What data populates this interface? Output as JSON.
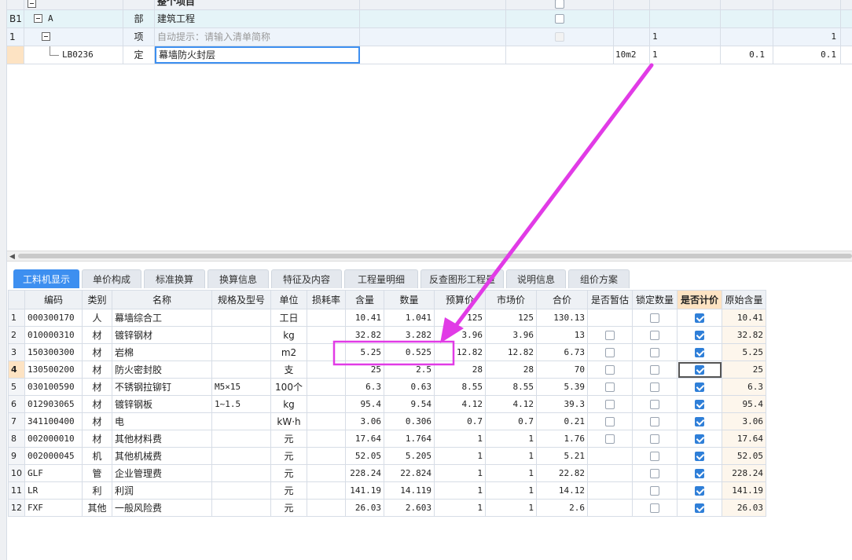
{
  "top_grid": {
    "header_title": "整个项目",
    "rows": [
      {
        "no": "B1",
        "code": "A",
        "type": "部",
        "name": "建筑工程",
        "name_hint": false,
        "unit": "",
        "qty_expr": "",
        "qty": "",
        "col_a": "",
        "col_b": "",
        "checkbox": "empty"
      },
      {
        "no": "1",
        "code": "",
        "type": "项",
        "name": "自动提示：请输入清单简称",
        "name_hint": true,
        "unit": "",
        "qty_expr": "1",
        "qty": "",
        "col_a": "",
        "col_b": "1",
        "checkbox": "dim"
      },
      {
        "no": "",
        "code": "LB0236",
        "type": "定",
        "name": "幕墙防火封层",
        "name_hint": false,
        "unit": "10m2",
        "qty_expr": "1",
        "qty": "",
        "col_a": "0.1",
        "col_b": "0.1",
        "checkbox": "none"
      }
    ]
  },
  "tabs": [
    "工料机显示",
    "单价构成",
    "标准换算",
    "换算信息",
    "特征及内容",
    "工程量明细",
    "反查图形工程量",
    "说明信息",
    "组价方案"
  ],
  "active_tab": 0,
  "table": {
    "headers": [
      "",
      "编码",
      "类别",
      "名称",
      "规格及型号",
      "单位",
      "损耗率",
      "含量",
      "数量",
      "预算价",
      "市场价",
      "合价",
      "是否暂估",
      "锁定数量",
      "是否计价",
      "原始含量"
    ],
    "highlight_header": 14,
    "selected_row": 3,
    "rows": [
      {
        "no": "1",
        "code": "000300170",
        "cat": "人",
        "name": "幕墙综合工",
        "spec": "",
        "unit": "工日",
        "loss": "",
        "content": "10.41",
        "qty": "1.041",
        "budget": "125",
        "market": "125",
        "total": "130.13",
        "est": false,
        "lock": true,
        "priced": true,
        "orig": "10.41"
      },
      {
        "no": "2",
        "code": "010000310",
        "cat": "材",
        "name": "镀锌钢材",
        "spec": "",
        "unit": "kg",
        "loss": "",
        "content": "32.82",
        "qty": "3.282",
        "budget": "3.96",
        "market": "3.96",
        "total": "13",
        "est": true,
        "lock": true,
        "priced": true,
        "orig": "32.82"
      },
      {
        "no": "3",
        "code": "150300300",
        "cat": "材",
        "name": "岩棉",
        "spec": "",
        "unit": "m2",
        "loss": "",
        "content": "5.25",
        "qty": "0.525",
        "budget": "12.82",
        "market": "12.82",
        "total": "6.73",
        "est": true,
        "lock": true,
        "priced": true,
        "orig": "5.25"
      },
      {
        "no": "4",
        "code": "130500200",
        "cat": "材",
        "name": "防火密封胶",
        "spec": "",
        "unit": "支",
        "loss": "",
        "content": "25",
        "qty": "2.5",
        "budget": "28",
        "market": "28",
        "total": "70",
        "est": true,
        "lock": true,
        "priced": true,
        "orig": "25"
      },
      {
        "no": "5",
        "code": "030100590",
        "cat": "材",
        "name": "不锈钢拉铆钉",
        "spec": "M5×15",
        "unit": "100个",
        "loss": "",
        "content": "6.3",
        "qty": "0.63",
        "budget": "8.55",
        "market": "8.55",
        "total": "5.39",
        "est": true,
        "lock": true,
        "priced": true,
        "orig": "6.3"
      },
      {
        "no": "6",
        "code": "012903065",
        "cat": "材",
        "name": "镀锌钢板",
        "spec": "1~1.5",
        "unit": "kg",
        "loss": "",
        "content": "95.4",
        "qty": "9.54",
        "budget": "4.12",
        "market": "4.12",
        "total": "39.3",
        "est": true,
        "lock": true,
        "priced": true,
        "orig": "95.4"
      },
      {
        "no": "7",
        "code": "341100400",
        "cat": "材",
        "name": "电",
        "spec": "",
        "unit": "kW·h",
        "loss": "",
        "content": "3.06",
        "qty": "0.306",
        "budget": "0.7",
        "market": "0.7",
        "total": "0.21",
        "est": true,
        "lock": true,
        "priced": true,
        "orig": "3.06"
      },
      {
        "no": "8",
        "code": "002000010",
        "cat": "材",
        "name": "其他材料费",
        "spec": "",
        "unit": "元",
        "loss": "",
        "content": "17.64",
        "qty": "1.764",
        "budget": "1",
        "market": "1",
        "total": "1.76",
        "est": true,
        "lock": true,
        "priced": true,
        "orig": "17.64"
      },
      {
        "no": "9",
        "code": "002000045",
        "cat": "机",
        "name": "其他机械费",
        "spec": "",
        "unit": "元",
        "loss": "",
        "content": "52.05",
        "qty": "5.205",
        "budget": "1",
        "market": "1",
        "total": "5.21",
        "est": false,
        "lock": true,
        "priced": true,
        "orig": "52.05"
      },
      {
        "no": "10",
        "code": "GLF",
        "cat": "管",
        "name": "企业管理费",
        "spec": "",
        "unit": "元",
        "loss": "",
        "content": "228.24",
        "qty": "22.824",
        "budget": "1",
        "market": "1",
        "total": "22.82",
        "est": false,
        "lock": true,
        "priced": true,
        "orig": "228.24"
      },
      {
        "no": "11",
        "code": "LR",
        "cat": "利",
        "name": "利润",
        "spec": "",
        "unit": "元",
        "loss": "",
        "content": "141.19",
        "qty": "14.119",
        "budget": "1",
        "market": "1",
        "total": "14.12",
        "est": false,
        "lock": true,
        "priced": true,
        "orig": "141.19"
      },
      {
        "no": "12",
        "code": "FXF",
        "cat": "其他",
        "name": "一般风险费",
        "spec": "",
        "unit": "元",
        "loss": "",
        "content": "26.03",
        "qty": "2.603",
        "budget": "1",
        "market": "1",
        "total": "2.6",
        "est": false,
        "lock": true,
        "priced": true,
        "orig": "26.03"
      }
    ]
  },
  "colors": {
    "annotation": "#e13be6",
    "active_tab": "#3d8ff0",
    "checkbox": "#2f7fd8",
    "highlight_header": "#fde3c3"
  }
}
